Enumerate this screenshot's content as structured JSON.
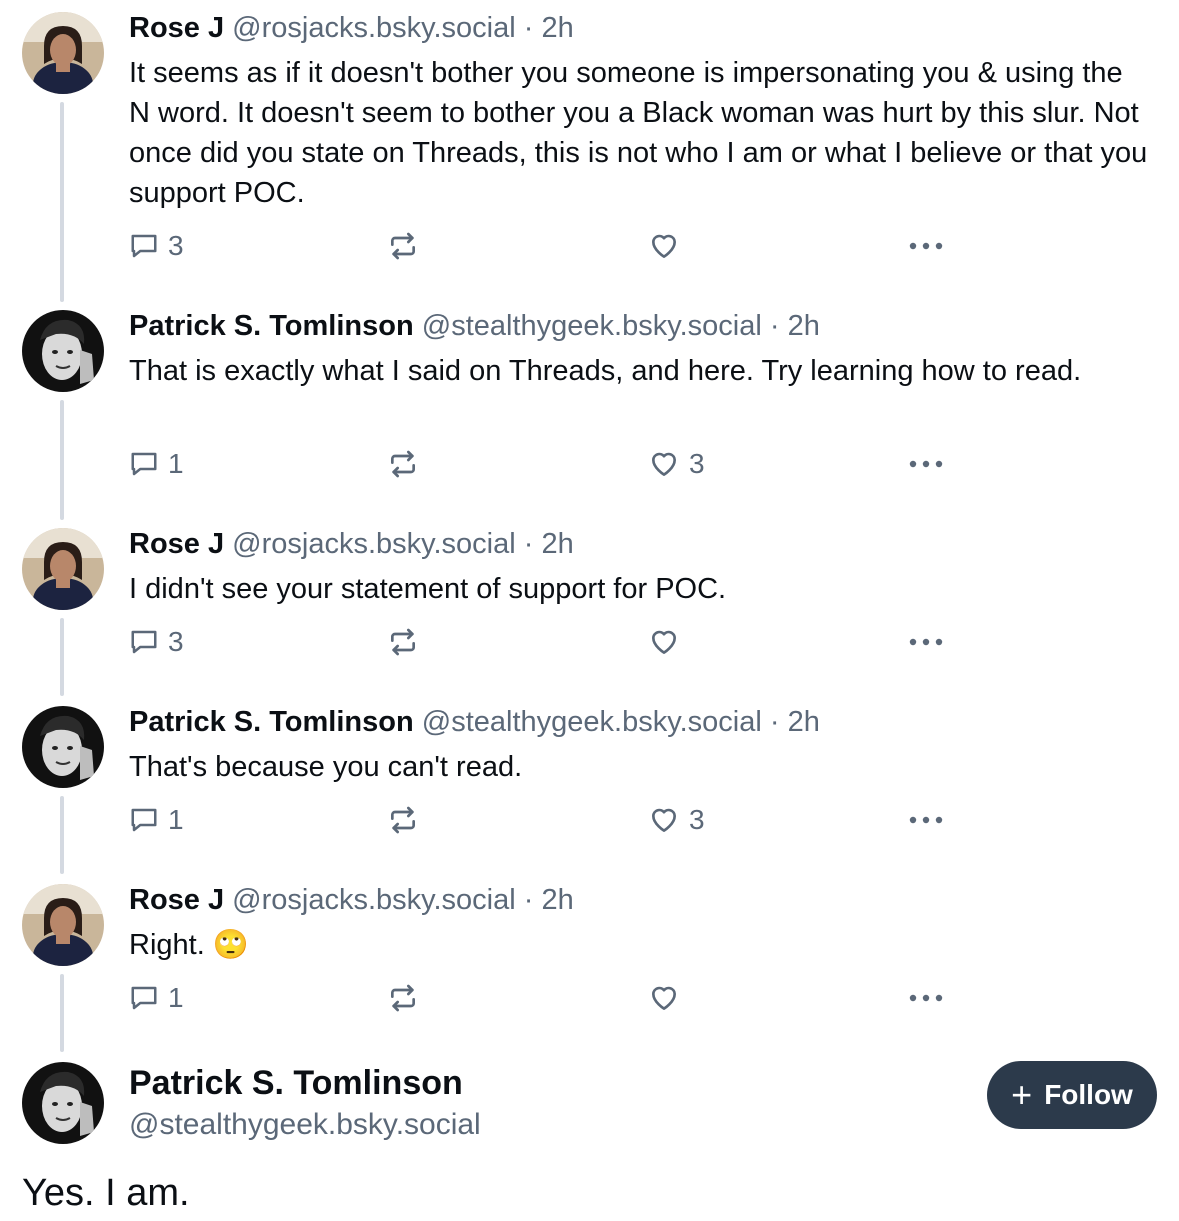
{
  "posts": [
    {
      "name": "Rose J",
      "handle": "@rosjacks.bsky.social",
      "sep": "·",
      "time": "2h",
      "text": "It seems as if it doesn't bother you someone is impersonating you & using the N word. It doesn't seem to bother you a Black woman was hurt by this slur. Not once did you state on Threads, this is not who I am or what I believe or that you support  POC.",
      "replies": "3",
      "likes": "",
      "avatar": "rose-avatar"
    },
    {
      "name": "Patrick S. Tomlinson",
      "handle": "@stealthygeek.bsky.social",
      "sep": "·",
      "time": "2h",
      "text": "That is exactly what I said on Threads, and here. Try learning how to read.",
      "replies": "1",
      "likes": "3",
      "avatar": "patrick-avatar"
    },
    {
      "name": "Rose J",
      "handle": "@rosjacks.bsky.social",
      "sep": "·",
      "time": "2h",
      "text": "I didn't see your statement of support for POC.",
      "replies": "3",
      "likes": "",
      "avatar": "rose-avatar"
    },
    {
      "name": "Patrick S. Tomlinson",
      "handle": "@stealthygeek.bsky.social",
      "sep": "·",
      "time": "2h",
      "text": "That's because you can't read.",
      "replies": "1",
      "likes": "3",
      "avatar": "patrick-avatar"
    },
    {
      "name": "Rose J",
      "handle": "@rosjacks.bsky.social",
      "sep": "·",
      "time": "2h",
      "text": "Right. 🙄",
      "replies": "1",
      "likes": "",
      "avatar": "rose-avatar"
    }
  ],
  "main_post": {
    "name": "Patrick S. Tomlinson",
    "handle": "@stealthygeek.bsky.social",
    "follow_icon": "plus-icon",
    "follow_label": "Follow",
    "text": "Yes. I am."
  },
  "icons": {
    "reply": "speech-bubble-icon",
    "repost": "repost-arrows-icon",
    "like": "heart-icon",
    "more": "ellipsis-icon"
  },
  "colors": {
    "text": "#0b0f14",
    "muted": "#5b6878",
    "thread_line": "#d4d9e1",
    "follow_bg": "#2c3a4b"
  }
}
